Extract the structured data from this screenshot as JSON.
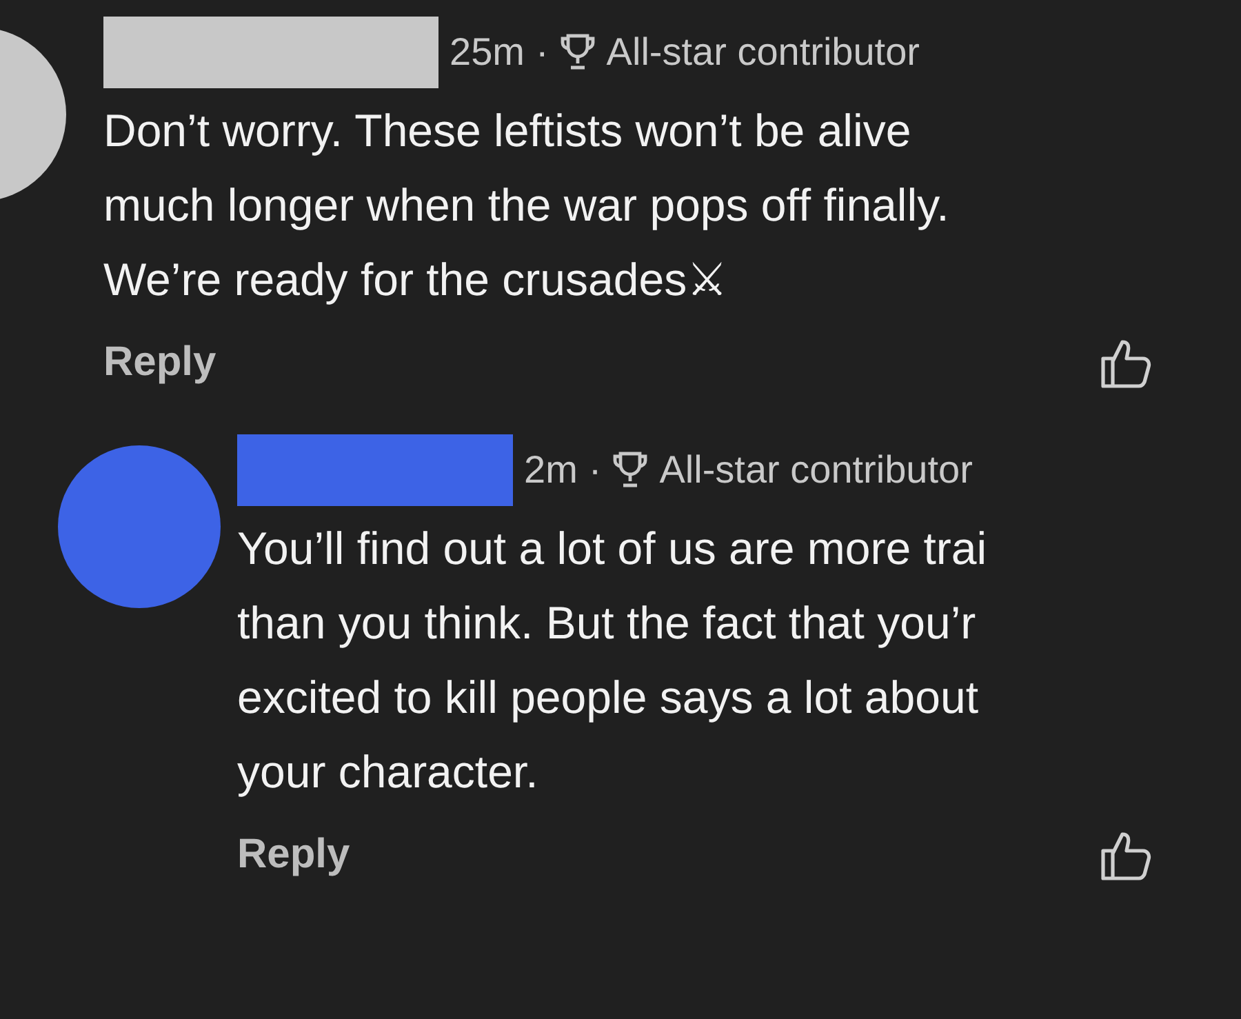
{
  "comments": [
    {
      "color": "#c8c8c8",
      "time": "25m",
      "separator": "·",
      "badge": "All-star contributor",
      "lines": [
        "Don’t worry. These leftists won’t be alive",
        "much longer when the war pops off finally.",
        "We’re ready for the crusades⚔"
      ],
      "reply": "Reply",
      "indent": false
    },
    {
      "color": "#3d63e6",
      "time": "2m",
      "separator": "·",
      "badge": "All-star contributor",
      "lines": [
        "You’ll find out a lot of us are more trai",
        "than you think. But the fact that you’r",
        "excited to kill people says a lot about",
        "your character."
      ],
      "reply": "Reply",
      "indent": true
    }
  ]
}
